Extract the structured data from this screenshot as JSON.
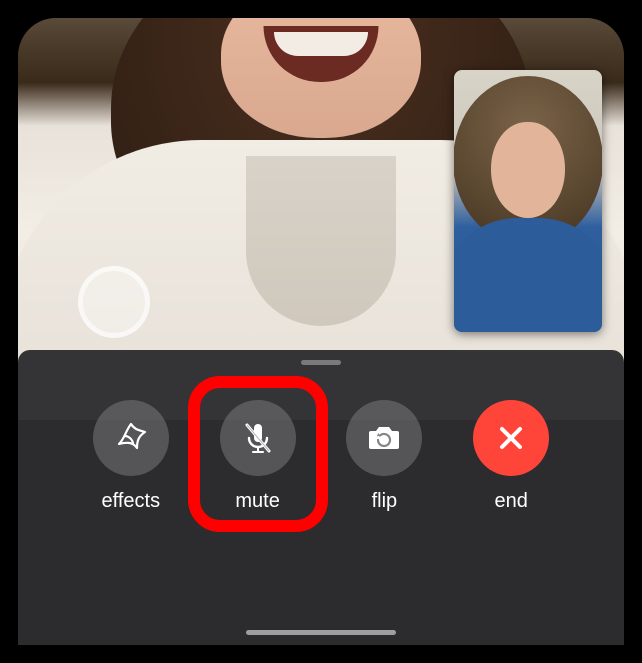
{
  "controls": {
    "effects": {
      "label": "effects",
      "icon": "star-swirl-icon"
    },
    "mute": {
      "label": "mute",
      "icon": "mic-slash-icon"
    },
    "flip": {
      "label": "flip",
      "icon": "camera-rotate-icon"
    },
    "end": {
      "label": "end",
      "icon": "close-x-icon"
    }
  },
  "highlight": {
    "target": "mute"
  },
  "colors": {
    "end_button": "#ff453a",
    "highlight_ring": "#ff0000",
    "panel_bg": "rgba(45,45,47,0.96)"
  }
}
